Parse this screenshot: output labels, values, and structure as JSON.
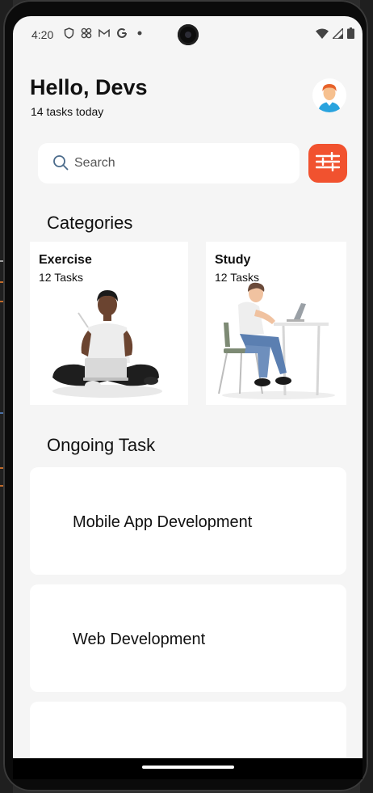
{
  "status_bar": {
    "time": "4:20",
    "left_icons": [
      "shield-icon",
      "pinwheel-icon",
      "gmail-icon",
      "google-icon",
      "dot-icon"
    ],
    "right_icons": [
      "wifi-icon",
      "signal-icon",
      "battery-icon"
    ]
  },
  "header": {
    "greeting": "Hello, Devs",
    "subtitle": "14 tasks today",
    "avatar_icon": "user-avatar-icon"
  },
  "search": {
    "placeholder": "Search",
    "value": "",
    "icon": "search-icon",
    "filter_icon": "sliders-icon"
  },
  "categories": {
    "title": "Categories",
    "items": [
      {
        "name": "Exercise",
        "count": "12 Tasks",
        "illustration": "person-with-laptop-sitting"
      },
      {
        "name": "Study",
        "count": "12 Tasks",
        "illustration": "person-at-desk"
      }
    ]
  },
  "ongoing": {
    "title": "Ongoing Task",
    "items": [
      {
        "label": "Mobile App Development"
      },
      {
        "label": "Web Development"
      },
      {
        "label": ""
      }
    ]
  },
  "colors": {
    "accent": "#f1522f",
    "background": "#f5f5f5",
    "card": "#ffffff",
    "text": "#111111"
  }
}
